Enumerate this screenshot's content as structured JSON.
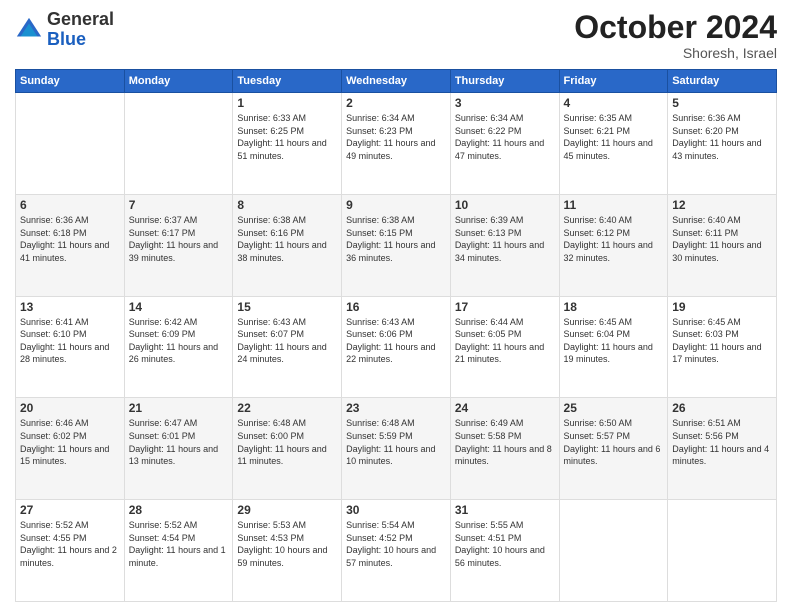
{
  "logo": {
    "general": "General",
    "blue": "Blue"
  },
  "header": {
    "month": "October 2024",
    "location": "Shoresh, Israel"
  },
  "weekdays": [
    "Sunday",
    "Monday",
    "Tuesday",
    "Wednesday",
    "Thursday",
    "Friday",
    "Saturday"
  ],
  "weeks": [
    [
      {
        "day": "",
        "info": ""
      },
      {
        "day": "",
        "info": ""
      },
      {
        "day": "1",
        "info": "Sunrise: 6:33 AM\nSunset: 6:25 PM\nDaylight: 11 hours and 51 minutes."
      },
      {
        "day": "2",
        "info": "Sunrise: 6:34 AM\nSunset: 6:23 PM\nDaylight: 11 hours and 49 minutes."
      },
      {
        "day": "3",
        "info": "Sunrise: 6:34 AM\nSunset: 6:22 PM\nDaylight: 11 hours and 47 minutes."
      },
      {
        "day": "4",
        "info": "Sunrise: 6:35 AM\nSunset: 6:21 PM\nDaylight: 11 hours and 45 minutes."
      },
      {
        "day": "5",
        "info": "Sunrise: 6:36 AM\nSunset: 6:20 PM\nDaylight: 11 hours and 43 minutes."
      }
    ],
    [
      {
        "day": "6",
        "info": "Sunrise: 6:36 AM\nSunset: 6:18 PM\nDaylight: 11 hours and 41 minutes."
      },
      {
        "day": "7",
        "info": "Sunrise: 6:37 AM\nSunset: 6:17 PM\nDaylight: 11 hours and 39 minutes."
      },
      {
        "day": "8",
        "info": "Sunrise: 6:38 AM\nSunset: 6:16 PM\nDaylight: 11 hours and 38 minutes."
      },
      {
        "day": "9",
        "info": "Sunrise: 6:38 AM\nSunset: 6:15 PM\nDaylight: 11 hours and 36 minutes."
      },
      {
        "day": "10",
        "info": "Sunrise: 6:39 AM\nSunset: 6:13 PM\nDaylight: 11 hours and 34 minutes."
      },
      {
        "day": "11",
        "info": "Sunrise: 6:40 AM\nSunset: 6:12 PM\nDaylight: 11 hours and 32 minutes."
      },
      {
        "day": "12",
        "info": "Sunrise: 6:40 AM\nSunset: 6:11 PM\nDaylight: 11 hours and 30 minutes."
      }
    ],
    [
      {
        "day": "13",
        "info": "Sunrise: 6:41 AM\nSunset: 6:10 PM\nDaylight: 11 hours and 28 minutes."
      },
      {
        "day": "14",
        "info": "Sunrise: 6:42 AM\nSunset: 6:09 PM\nDaylight: 11 hours and 26 minutes."
      },
      {
        "day": "15",
        "info": "Sunrise: 6:43 AM\nSunset: 6:07 PM\nDaylight: 11 hours and 24 minutes."
      },
      {
        "day": "16",
        "info": "Sunrise: 6:43 AM\nSunset: 6:06 PM\nDaylight: 11 hours and 22 minutes."
      },
      {
        "day": "17",
        "info": "Sunrise: 6:44 AM\nSunset: 6:05 PM\nDaylight: 11 hours and 21 minutes."
      },
      {
        "day": "18",
        "info": "Sunrise: 6:45 AM\nSunset: 6:04 PM\nDaylight: 11 hours and 19 minutes."
      },
      {
        "day": "19",
        "info": "Sunrise: 6:45 AM\nSunset: 6:03 PM\nDaylight: 11 hours and 17 minutes."
      }
    ],
    [
      {
        "day": "20",
        "info": "Sunrise: 6:46 AM\nSunset: 6:02 PM\nDaylight: 11 hours and 15 minutes."
      },
      {
        "day": "21",
        "info": "Sunrise: 6:47 AM\nSunset: 6:01 PM\nDaylight: 11 hours and 13 minutes."
      },
      {
        "day": "22",
        "info": "Sunrise: 6:48 AM\nSunset: 6:00 PM\nDaylight: 11 hours and 11 minutes."
      },
      {
        "day": "23",
        "info": "Sunrise: 6:48 AM\nSunset: 5:59 PM\nDaylight: 11 hours and 10 minutes."
      },
      {
        "day": "24",
        "info": "Sunrise: 6:49 AM\nSunset: 5:58 PM\nDaylight: 11 hours and 8 minutes."
      },
      {
        "day": "25",
        "info": "Sunrise: 6:50 AM\nSunset: 5:57 PM\nDaylight: 11 hours and 6 minutes."
      },
      {
        "day": "26",
        "info": "Sunrise: 6:51 AM\nSunset: 5:56 PM\nDaylight: 11 hours and 4 minutes."
      }
    ],
    [
      {
        "day": "27",
        "info": "Sunrise: 5:52 AM\nSunset: 4:55 PM\nDaylight: 11 hours and 2 minutes."
      },
      {
        "day": "28",
        "info": "Sunrise: 5:52 AM\nSunset: 4:54 PM\nDaylight: 11 hours and 1 minute."
      },
      {
        "day": "29",
        "info": "Sunrise: 5:53 AM\nSunset: 4:53 PM\nDaylight: 10 hours and 59 minutes."
      },
      {
        "day": "30",
        "info": "Sunrise: 5:54 AM\nSunset: 4:52 PM\nDaylight: 10 hours and 57 minutes."
      },
      {
        "day": "31",
        "info": "Sunrise: 5:55 AM\nSunset: 4:51 PM\nDaylight: 10 hours and 56 minutes."
      },
      {
        "day": "",
        "info": ""
      },
      {
        "day": "",
        "info": ""
      }
    ]
  ]
}
